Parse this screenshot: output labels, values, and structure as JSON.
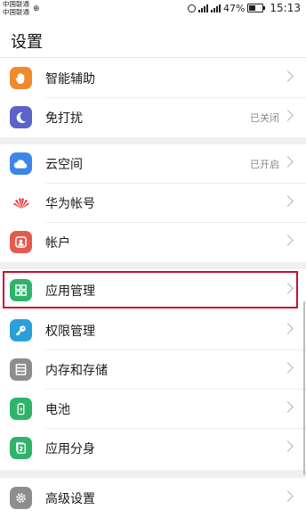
{
  "status_bar": {
    "carrier_1": "中国联通",
    "carrier_2": "中国联通",
    "battery_percent": "47%",
    "battery_level": 0.47,
    "time": "15:13",
    "network_1": "2G",
    "network_2": "4G"
  },
  "page": {
    "title": "设置"
  },
  "settings": [
    {
      "label": "智能辅助",
      "value": "",
      "icon": "hand-icon",
      "color": "#f08a2c"
    },
    {
      "label": "免打扰",
      "value": "",
      "status": "已关闭",
      "icon": "moon-icon",
      "color": "#5b62c8"
    },
    {
      "label": "云空间",
      "value": "",
      "status": "已开启",
      "icon": "cloud-icon",
      "color": "#3d86e8"
    },
    {
      "label": "华为帐号",
      "value": "",
      "icon": "huawei-logo-icon",
      "color": "#e8383d"
    },
    {
      "label": "帐户",
      "value": "",
      "icon": "account-icon",
      "color": "#e55a4e"
    },
    {
      "label": "应用管理",
      "value": "",
      "icon": "apps-grid-icon",
      "color": "#2fb36a"
    },
    {
      "label": "权限管理",
      "value": "",
      "icon": "key-icon",
      "color": "#2ba0d8"
    },
    {
      "label": "内存和存储",
      "value": "",
      "icon": "storage-icon",
      "color": "#8d8d8d"
    },
    {
      "label": "电池",
      "value": "",
      "icon": "battery-icon",
      "color": "#2fb36a"
    },
    {
      "label": "应用分身",
      "value": "",
      "icon": "app-twin-icon",
      "color": "#2fb36a"
    },
    {
      "label": "高级设置",
      "value": "",
      "icon": "gear-icon",
      "color": "#8d8d8d"
    }
  ]
}
